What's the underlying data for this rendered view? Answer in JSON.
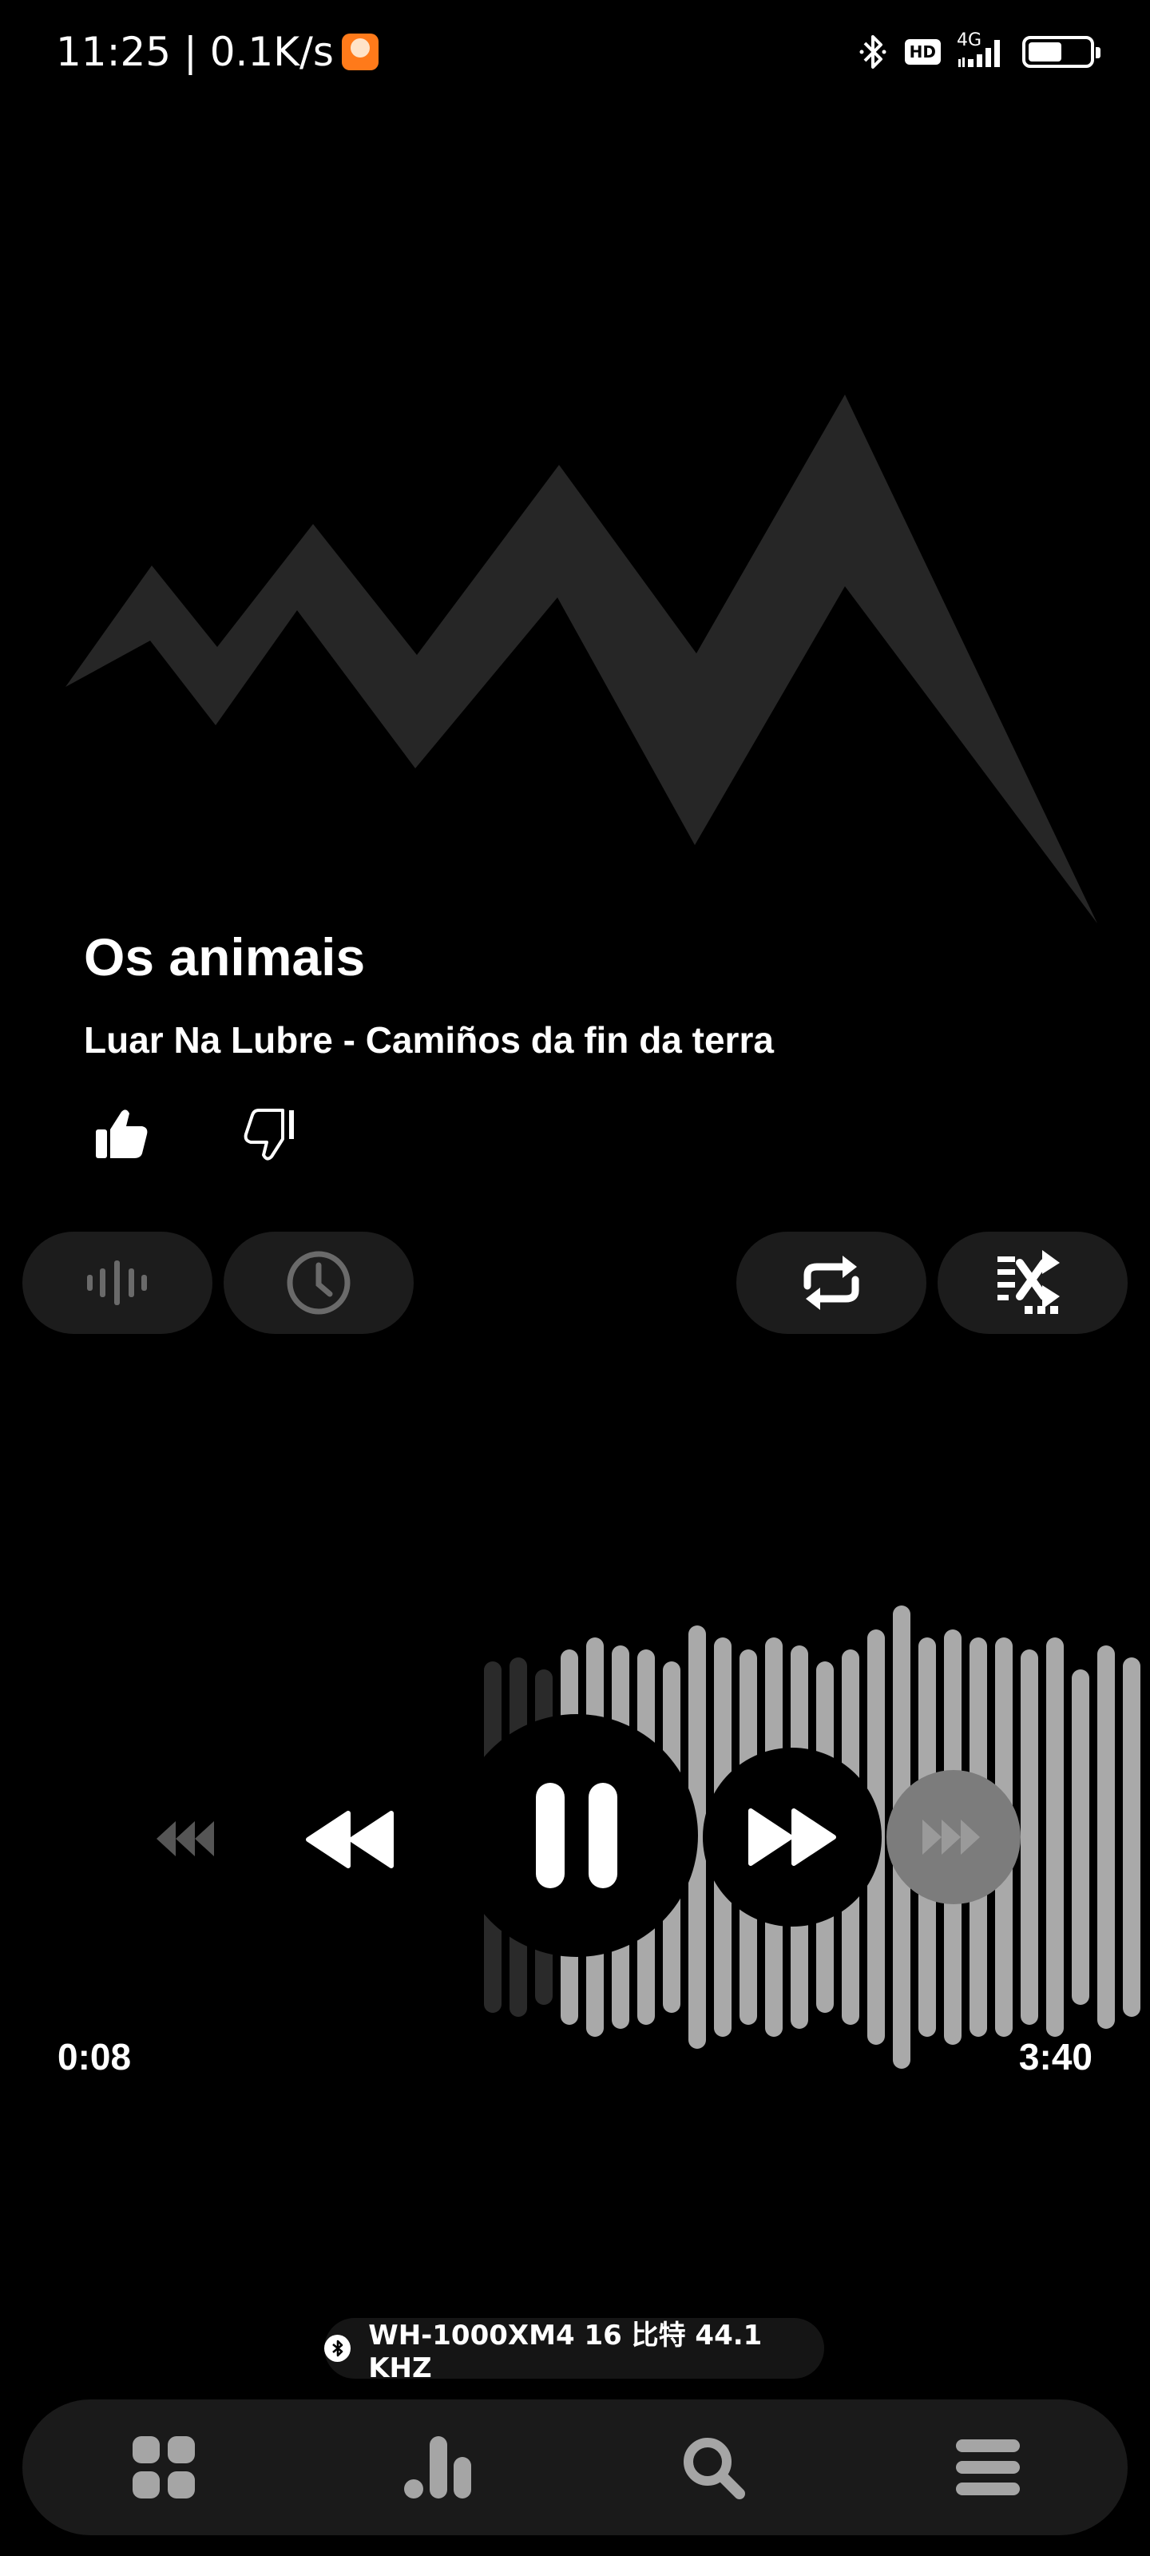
{
  "status_bar": {
    "time_speed": "11:25 | 0.1K/s",
    "hd": "HD",
    "network": "4G"
  },
  "track": {
    "title": "Os animais",
    "subtitle": "Luar Na Lubre - Camiños da fin da terra"
  },
  "player": {
    "elapsed": "0:08",
    "duration": "3:40",
    "state": "playing"
  },
  "device": {
    "label": "WH-1000XM4 16 比特 44.1 KHZ"
  },
  "colors": {
    "background": "#000000",
    "pill": "#1c1c1c",
    "wave_played": "#2a2a2a",
    "wave_unplayed": "#a9a9a9",
    "artwork": "#262626"
  },
  "icons": {
    "left_pills": [
      "waveform-icon",
      "clock-icon"
    ],
    "right_pills": [
      "repeat-icon",
      "shuffle-queue-icon"
    ],
    "bottom_nav": [
      "grid-icon",
      "bar-chart-icon",
      "search-icon",
      "menu-icon"
    ]
  }
}
